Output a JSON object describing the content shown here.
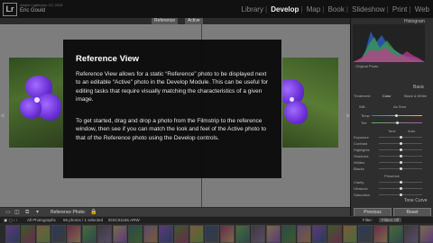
{
  "app": {
    "logo": "Lr",
    "title_small": "Adobe Lightroom CC 2015",
    "user": "Eric Gould"
  },
  "modules": [
    {
      "label": "Library",
      "active": false
    },
    {
      "label": "Develop",
      "active": true
    },
    {
      "label": "Map",
      "active": false
    },
    {
      "label": "Book",
      "active": false
    },
    {
      "label": "Slideshow",
      "active": false
    },
    {
      "label": "Print",
      "active": false
    },
    {
      "label": "Web",
      "active": false
    }
  ],
  "compare": {
    "reference_label": "Reference",
    "active_label": "Active"
  },
  "overlay": {
    "title": "Reference View",
    "paragraph1": "Reference View allows for a static “Reference” photo to be displayed next to an editable “Active” photo in the Develop Module. This can be useful for editing tasks that require visually matching the characteristics of a given image.",
    "paragraph2": "To get started, drag and drop a photo from the Filmstrip to the reference window, then see if you can match the look and feel of the Active photo to that of the Reference photo using the Develop controls."
  },
  "toolbar": {
    "reference_photo_label": "Reference Photo:"
  },
  "right_panel": {
    "histogram_label": "Histogram",
    "original_photo_label": "Original Photo",
    "basic_label": "Basic",
    "treatment_label": "Treatment :",
    "treatment_color": "Color",
    "treatment_bw": "Black & White",
    "wb_label": "WB :",
    "wb_value": "As Shot",
    "temp_label": "Temp",
    "tint_label": "Tint",
    "tone_label": "Tone",
    "tone_auto": "Auto",
    "tone_sliders": [
      "Exposure",
      "Contrast",
      "Highlights",
      "Shadows",
      "Whites",
      "Blacks"
    ],
    "presence_label": "Presence",
    "presence_sliders": [
      "Clarity",
      "Vibrance",
      "Saturation"
    ],
    "tone_curve_label": "Tone Curve",
    "previous_button": "Previous",
    "reset_button": "Reset"
  },
  "filmstrip_bar": {
    "source": "All Photographs",
    "count": "66 photos / 1 selected",
    "filename": "/DSC01166.ARW",
    "filter_label": "Filter :",
    "filter_value": "Filters Off"
  },
  "colors": {
    "accent_active_module": "#eeeeee",
    "overlay_bg": "#080808",
    "view_bg": "#7d7d7d"
  }
}
